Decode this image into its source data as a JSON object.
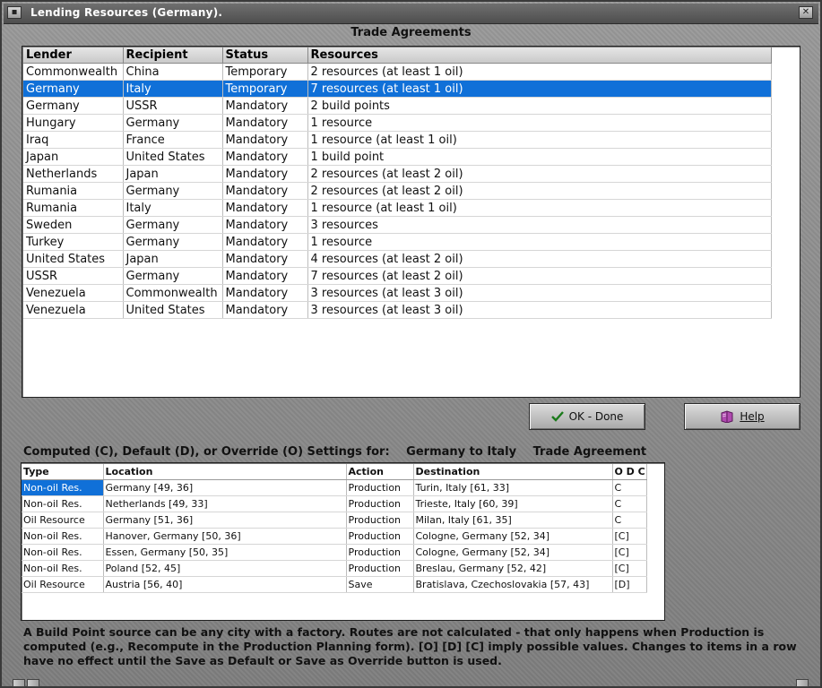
{
  "window": {
    "title": "Lending Resources (Germany).",
    "section_title": "Trade Agreements"
  },
  "trade_table": {
    "headers": [
      "Lender",
      "Recipient",
      "Status",
      "Resources"
    ],
    "selected_row": 1,
    "rows": [
      [
        "Commonwealth",
        "China",
        "Temporary",
        "2 resources (at least 1 oil)"
      ],
      [
        "Germany",
        "Italy",
        "Temporary",
        "7 resources (at least 1 oil)"
      ],
      [
        "Germany",
        "USSR",
        "Mandatory",
        "2 build points"
      ],
      [
        "Hungary",
        "Germany",
        "Mandatory",
        "1 resource"
      ],
      [
        "Iraq",
        "France",
        "Mandatory",
        "1 resource (at least 1 oil)"
      ],
      [
        "Japan",
        "United States",
        "Mandatory",
        "1 build point"
      ],
      [
        "Netherlands",
        "Japan",
        "Mandatory",
        "2 resources (at least 2 oil)"
      ],
      [
        "Rumania",
        "Germany",
        "Mandatory",
        "2 resources (at least 2 oil)"
      ],
      [
        "Rumania",
        "Italy",
        "Mandatory",
        "1 resource (at least 1 oil)"
      ],
      [
        "Sweden",
        "Germany",
        "Mandatory",
        "3 resources"
      ],
      [
        "Turkey",
        "Germany",
        "Mandatory",
        "1 resource"
      ],
      [
        "United States",
        "Japan",
        "Mandatory",
        "4 resources (at least 2 oil)"
      ],
      [
        "USSR",
        "Germany",
        "Mandatory",
        "7 resources (at least 2 oil)"
      ],
      [
        "Venezuela",
        "Commonwealth",
        "Mandatory",
        "3 resources (at least 3 oil)"
      ],
      [
        "Venezuela",
        "United States",
        "Mandatory",
        "3 resources (at least 3 oil)"
      ]
    ]
  },
  "buttons": {
    "ok_label": "OK - Done",
    "help_label": "Help"
  },
  "settings": {
    "label_prefix": "Computed (C), Default (D), or Override (O) Settings for:",
    "agreement_parties": "Germany to Italy",
    "agreement_kind": "Trade Agreement",
    "headers": [
      "Type",
      "Location",
      "Action",
      "Destination",
      "O D C"
    ],
    "rows": [
      [
        "Non-oil Res.",
        "Germany [49, 36]",
        "Production",
        "Turin, Italy [61, 33]",
        "C"
      ],
      [
        "Non-oil Res.",
        "Netherlands [49, 33]",
        "Production",
        "Trieste, Italy [60, 39]",
        "C"
      ],
      [
        "Oil Resource",
        "Germany [51, 36]",
        "Production",
        "Milan, Italy [61, 35]",
        "C"
      ],
      [
        "Non-oil Res.",
        "Hanover, Germany [50, 36]",
        "Production",
        "Cologne, Germany [52, 34]",
        "[C]"
      ],
      [
        "Non-oil Res.",
        "Essen, Germany [50, 35]",
        "Production",
        "Cologne, Germany [52, 34]",
        "[C]"
      ],
      [
        "Non-oil Res.",
        "Poland [52, 45]",
        "Production",
        "Breslau, Germany [52, 42]",
        "[C]"
      ],
      [
        "Oil Resource",
        "Austria [56, 40]",
        "Save",
        "Bratislava, Czechoslovakia [57, 43]",
        "[D]"
      ]
    ]
  },
  "note": "A Build Point source can be any city with a factory. Routes are not calculated - that only happens when Production is computed (e.g., Recompute in the Production Planning form).  [O] [D] [C] imply possible values.  Changes to items in a row have no effect until the Save as Default or Save as Override button is used.",
  "icons": {
    "ok": "checkmark-icon",
    "help": "book-icon",
    "sys_menu": "window-menu-icon",
    "close": "close-icon"
  },
  "colors": {
    "selection": "#1070d8",
    "titlebar": "#5a5a5a",
    "checkmark": "#1a7a1a",
    "book": "#8a2a8a"
  }
}
